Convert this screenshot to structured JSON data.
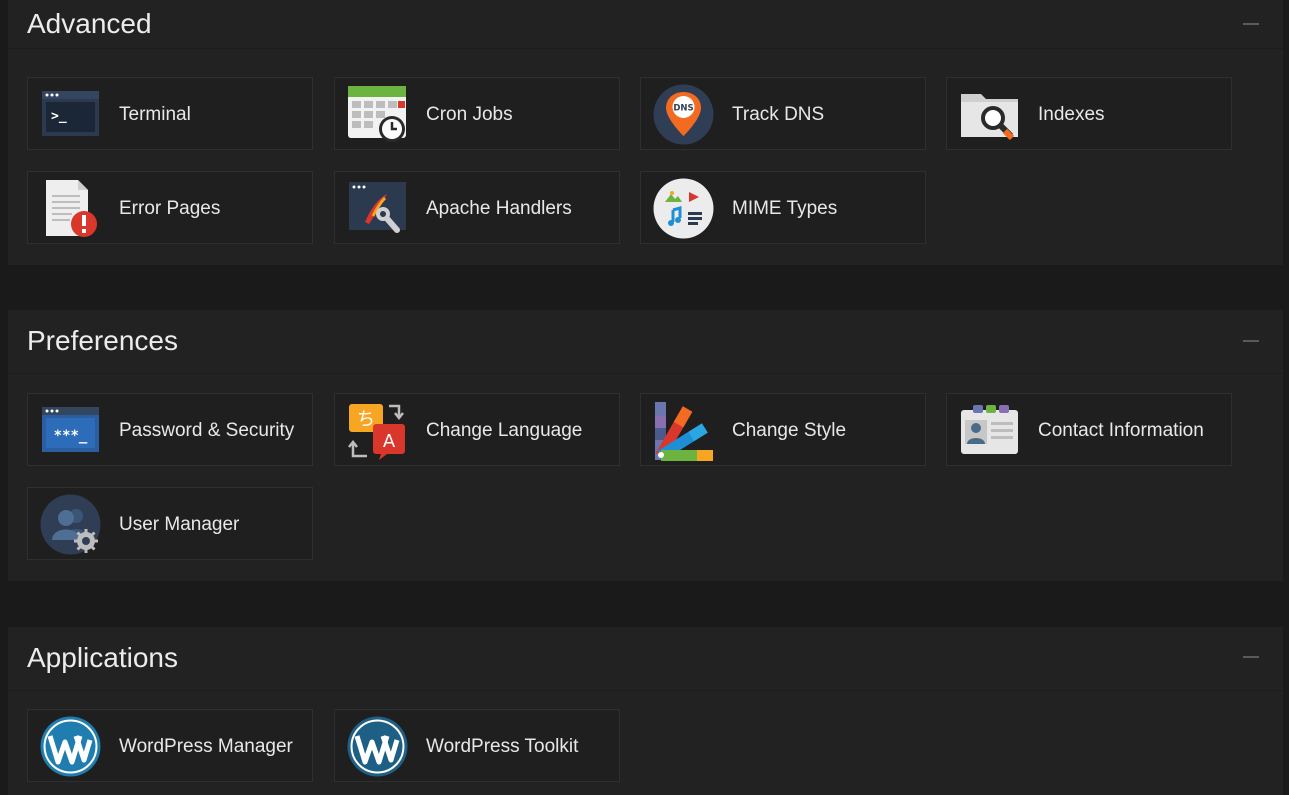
{
  "sections": {
    "advanced": {
      "title": "Advanced",
      "items": [
        {
          "label": "Terminal",
          "icon": "terminal-icon"
        },
        {
          "label": "Cron Jobs",
          "icon": "calendar-clock-icon"
        },
        {
          "label": "Track DNS",
          "icon": "dns-pin-icon"
        },
        {
          "label": "Indexes",
          "icon": "folder-search-icon"
        },
        {
          "label": "Error Pages",
          "icon": "error-document-icon"
        },
        {
          "label": "Apache Handlers",
          "icon": "handler-wrench-icon"
        },
        {
          "label": "MIME Types",
          "icon": "mime-media-icon"
        }
      ]
    },
    "preferences": {
      "title": "Preferences",
      "items": [
        {
          "label": "Password & Security",
          "icon": "password-icon"
        },
        {
          "label": "Change Language",
          "icon": "language-icon"
        },
        {
          "label": "Change Style",
          "icon": "color-swatch-icon"
        },
        {
          "label": "Contact Information",
          "icon": "contact-card-icon"
        },
        {
          "label": "User Manager",
          "icon": "users-gear-icon"
        }
      ]
    },
    "applications": {
      "title": "Applications",
      "items": [
        {
          "label": "WordPress Manager",
          "icon": "wordpress-icon"
        },
        {
          "label": "WordPress Toolkit",
          "icon": "wordpress-icon"
        }
      ]
    }
  },
  "colors": {
    "background": "#1a1a1a",
    "panel": "#222222",
    "tile": "#1f1f1f",
    "tile_border": "#2f2f2f",
    "text": "#e8e8e8"
  }
}
